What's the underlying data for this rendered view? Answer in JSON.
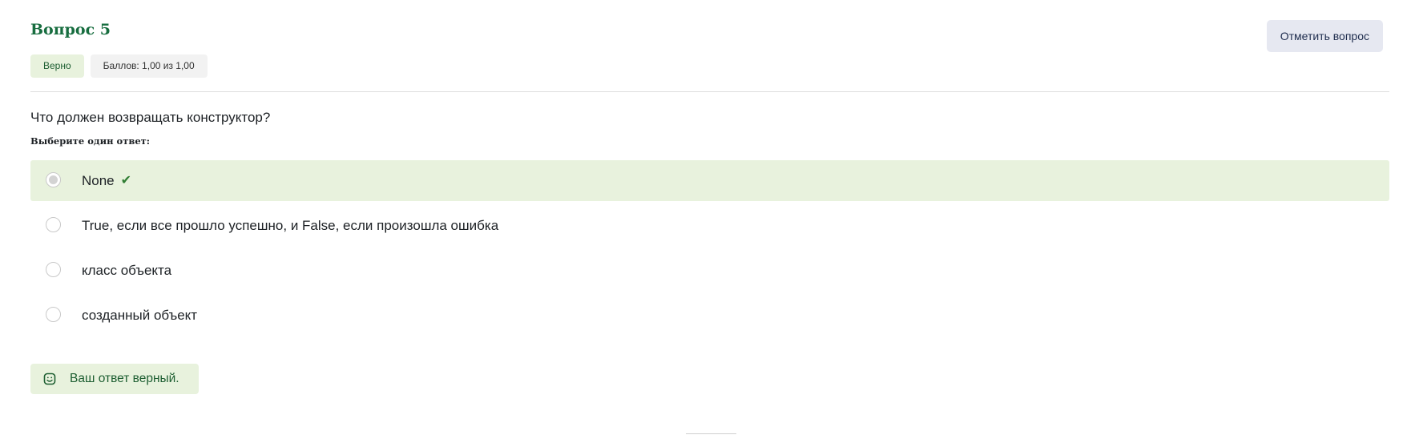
{
  "question": {
    "title": "Вопрос 5",
    "status_badge": "Верно",
    "grade_badge": "Баллов: 1,00 из 1,00",
    "flag_button": "Отметить вопрос",
    "text": "Что должен возвращать конструктор?",
    "prompt": "Выберите один ответ:",
    "answers": [
      {
        "label": "None",
        "selected": true,
        "correct": true
      },
      {
        "label": "True, если все прошло успешно, и False, если произошла ошибка",
        "selected": false,
        "correct": false
      },
      {
        "label": "класс объекта",
        "selected": false,
        "correct": false
      },
      {
        "label": "созданный объект",
        "selected": false,
        "correct": false
      }
    ],
    "feedback": "Ваш ответ верный."
  },
  "colors": {
    "accent_green": "#176d3f",
    "correct_bg": "#e8f2dd",
    "flag_bg": "#e6e8f1"
  },
  "icons": {
    "check": "check-icon",
    "feedback": "smile-icon"
  }
}
